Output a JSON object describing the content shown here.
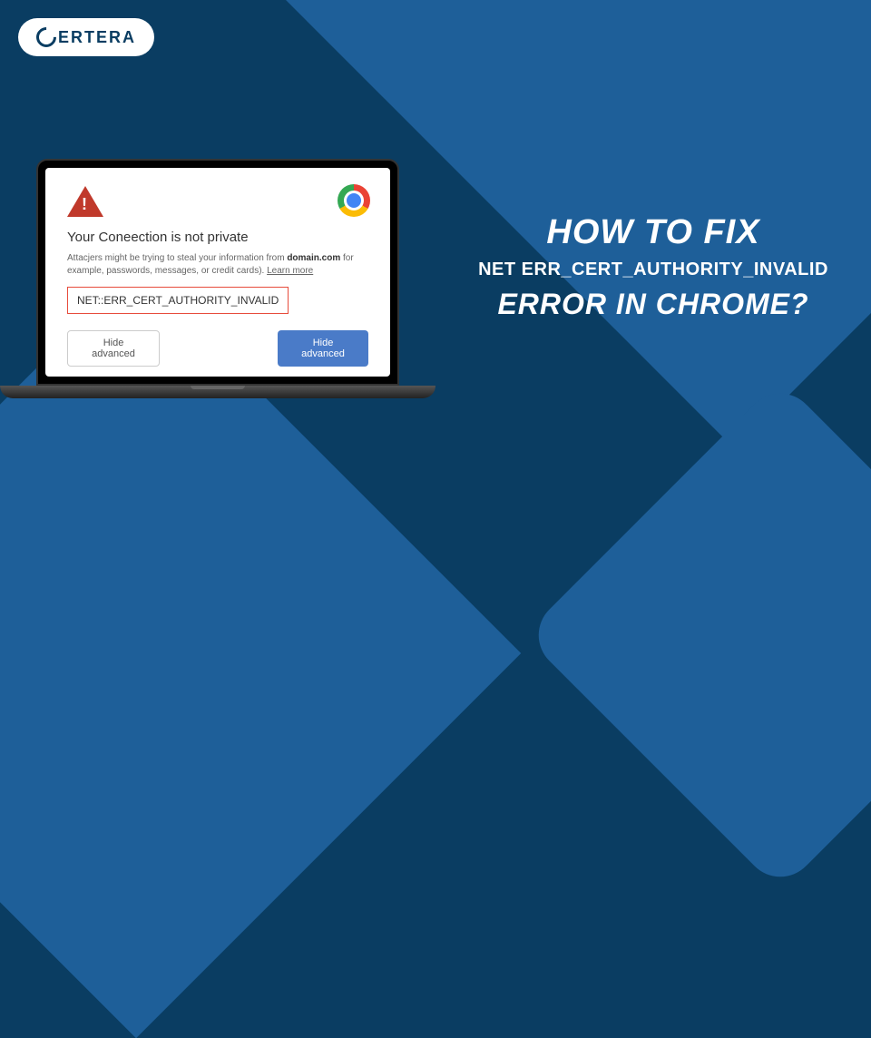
{
  "logo": {
    "text": "ERTERA"
  },
  "dialog": {
    "title": "Your Coneection is not private",
    "warning_text_1": "Attacjers might be trying to steal your information from ",
    "warning_domain": "domain.com",
    "warning_text_2": " for example, passwords, messages, or credit cards). ",
    "learn_more": "Learn more",
    "error_code": "NET::ERR_CERT_AUTHORITY_INVALID",
    "btn_hide_left": "Hide advanced",
    "btn_hide_right": "Hide advanced"
  },
  "headline": {
    "line1": "HOW TO FIX",
    "line2": "NET ERR_CERT_AUTHORITY_INVALID",
    "line3": "ERROR IN CHROME?"
  }
}
